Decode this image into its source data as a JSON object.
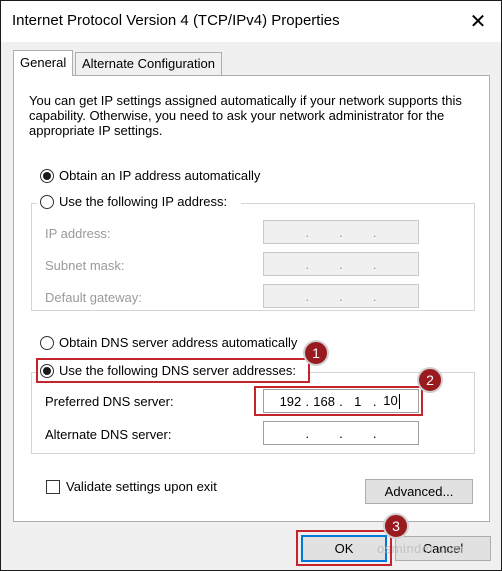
{
  "window": {
    "title": "Internet Protocol Version 4 (TCP/IPv4) Properties",
    "close_symbol": "✕"
  },
  "tabs": [
    {
      "label": "General",
      "active": true
    },
    {
      "label": "Alternate Configuration",
      "active": false
    }
  ],
  "description": "You can get IP settings assigned automatically if your network supports this capability. Otherwise, you need to ask your network administrator for the appropriate IP settings.",
  "ip": {
    "auto_label": "Obtain an IP address automatically",
    "manual_label": "Use the following IP address:",
    "fields": [
      {
        "label": "IP address:",
        "value": ""
      },
      {
        "label": "Subnet mask:",
        "value": ""
      },
      {
        "label": "Default gateway:",
        "value": ""
      }
    ]
  },
  "dns": {
    "auto_label": "Obtain DNS server address automatically",
    "manual_label": "Use the following DNS server addresses:",
    "preferred_label": "Preferred DNS server:",
    "preferred_value": [
      "192",
      "168",
      "1",
      "10"
    ],
    "alternate_label": "Alternate DNS server:",
    "alternate_value": [
      "",
      "",
      "",
      ""
    ]
  },
  "validate_label": "Validate settings upon exit",
  "buttons": {
    "advanced": "Advanced...",
    "ok": "OK",
    "cancel": "Cancel"
  },
  "annotations": {
    "step1": "1",
    "step2": "2",
    "step3": "3",
    "highlight_color": "#c4242b",
    "badge_color": "#9a1b1f"
  },
  "watermark": "osminder.com"
}
